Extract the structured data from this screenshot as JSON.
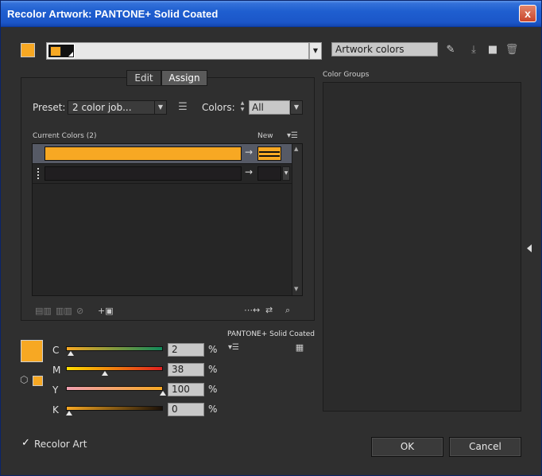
{
  "window": {
    "title": "Recolor Artwork: PANTONE+ Solid Coated",
    "close_label": "x"
  },
  "top": {
    "group_name": "Artwork colors"
  },
  "sections": {
    "color_groups": "Color Groups"
  },
  "tabs": [
    {
      "label": "Edit"
    },
    {
      "label": "Assign"
    }
  ],
  "preset": {
    "label": "Preset:",
    "value": "2 color job..."
  },
  "colors": {
    "label": "Colors:",
    "value": "All"
  },
  "list": {
    "current_label": "Current Colors (2)",
    "new_label": "New",
    "rows": [
      {
        "current": "#f7a823",
        "new": "#f7a823",
        "selected": true
      },
      {
        "current": "#201e20",
        "new": "#201e20",
        "selected": false
      }
    ]
  },
  "library": {
    "label": "PANTONE+ Solid Coated"
  },
  "sliders": [
    {
      "letter": "C",
      "value": "2",
      "unit": "%",
      "gradient": "linear-gradient(to right,#f7a823,#10895a)",
      "fraction": 0.02
    },
    {
      "letter": "M",
      "value": "38",
      "unit": "%",
      "gradient": "linear-gradient(to right,#ffdd00,#e02020)",
      "fraction": 0.38
    },
    {
      "letter": "Y",
      "value": "100",
      "unit": "%",
      "gradient": "linear-gradient(to right,#f0a0b0,#f7a823)",
      "fraction": 1.0
    },
    {
      "letter": "K",
      "value": "0",
      "unit": "%",
      "gradient": "linear-gradient(to right,#f7a823,#1a1008)",
      "fraction": 0.0
    }
  ],
  "footer": {
    "recolor_art": "Recolor Art",
    "ok": "OK",
    "cancel": "Cancel"
  },
  "colors_palette": {
    "accent": "#f7a823"
  }
}
